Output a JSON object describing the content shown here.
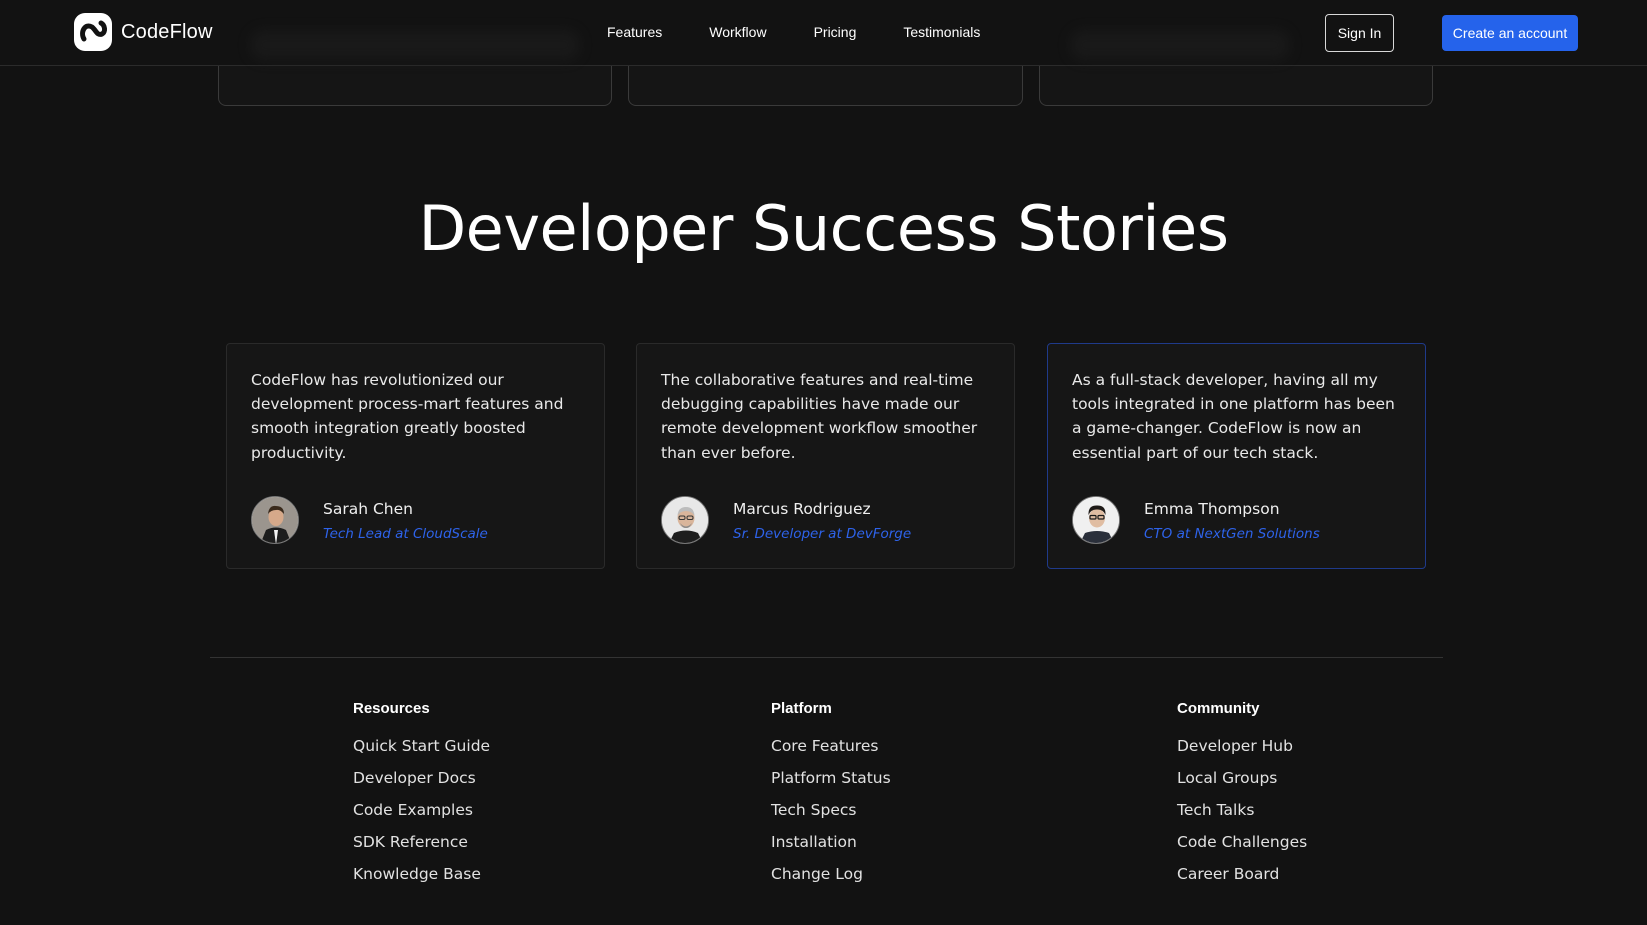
{
  "header": {
    "brand": "CodeFlow",
    "nav": [
      "Features",
      "Workflow",
      "Pricing",
      "Testimonials"
    ],
    "sign_in": "Sign In",
    "create_account": "Create an account"
  },
  "testimonials": {
    "title": "Developer Success Stories",
    "items": [
      {
        "quote": "CodeFlow has revolutionized our development process-mart features and smooth integration greatly boosted productivity.",
        "name": "Sarah Chen",
        "role": "Tech Lead at CloudScale"
      },
      {
        "quote": "The collaborative features and real-time debugging capabilities have made our remote development workflow smoother than ever before.",
        "name": "Marcus Rodriguez",
        "role": "Sr. Developer at DevForge"
      },
      {
        "quote": "As a full-stack developer, having all my tools integrated in one platform has been a game-changer. CodeFlow is now an essential part of our tech stack.",
        "name": "Emma Thompson",
        "role": "CTO at NextGen Solutions"
      }
    ]
  },
  "footer": {
    "columns": [
      {
        "title": "Resources",
        "links": [
          "Quick Start Guide",
          "Developer Docs",
          "Code Examples",
          "SDK Reference",
          "Knowledge Base"
        ]
      },
      {
        "title": "Platform",
        "links": [
          "Core Features",
          "Platform Status",
          "Tech Specs",
          "Installation",
          "Change Log"
        ]
      },
      {
        "title": "Community",
        "links": [
          "Developer Hub",
          "Local Groups",
          "Tech Talks",
          "Code Challenges",
          "Career Board"
        ]
      }
    ]
  },
  "colors": {
    "background": "#121212",
    "accent": "#2563eb",
    "role_text": "#2e63ea",
    "card_border": "#2a2a2a"
  }
}
